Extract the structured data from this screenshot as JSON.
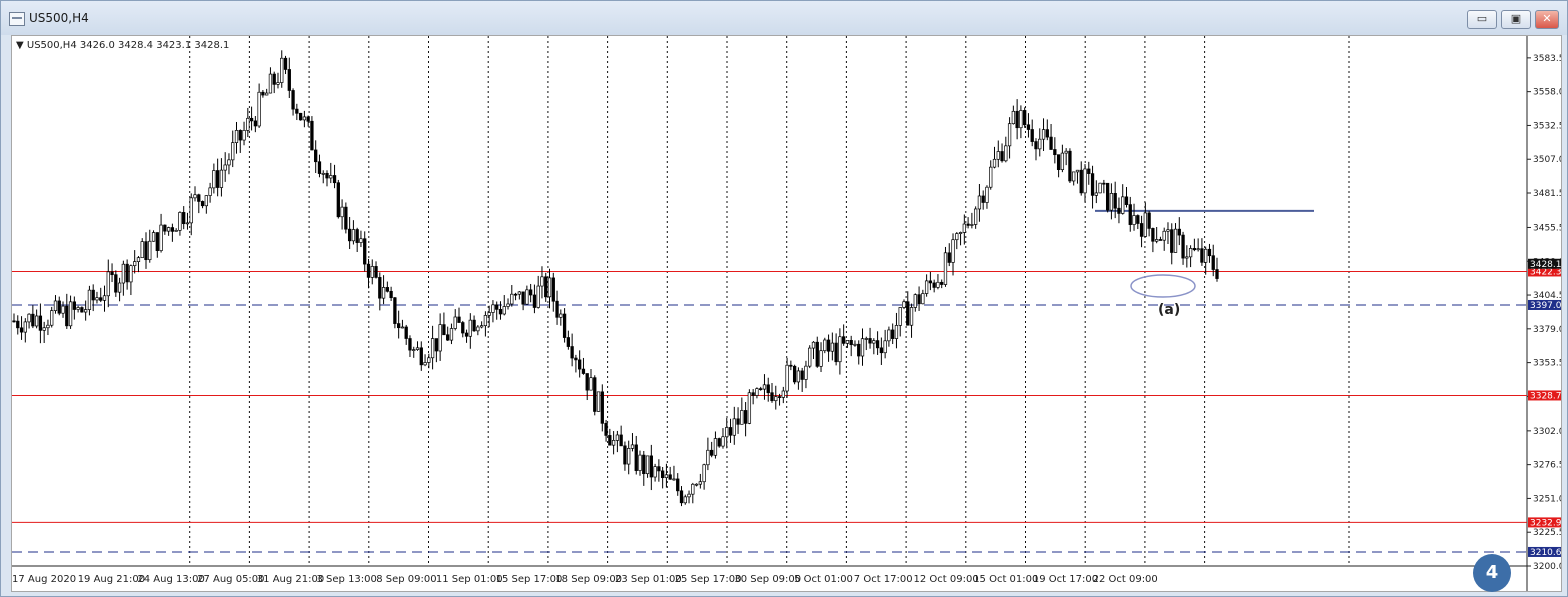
{
  "window": {
    "title": "US500,H4"
  },
  "window_buttons": {
    "minimize": "▭",
    "restore": "▣",
    "close": "✕"
  },
  "chart": {
    "info_text": "▼ US500,H4  3426.0 3428.4 3423.1 3428.1",
    "price_ticks": [
      "3583.5",
      "3558.0",
      "3532.5",
      "3507.0",
      "3481.5",
      "3455.5",
      "3430.0",
      "3404.5",
      "3379.0",
      "3353.5",
      "3328.0",
      "3302.0",
      "3276.5",
      "3251.0",
      "3225.5",
      "3200.0"
    ],
    "price_tick_values": [
      3583.5,
      3558.0,
      3532.5,
      3507.0,
      3481.5,
      3455.5,
      3430.0,
      3404.5,
      3379.0,
      3353.5,
      3328.0,
      3302.0,
      3276.5,
      3251.0,
      3225.5,
      3200.0
    ],
    "time_labels": [
      "17 Aug 2020",
      "19 Aug 21:00",
      "24 Aug 13:00",
      "27 Aug 05:00",
      "31 Aug 21:00",
      "3 Sep 13:00",
      "8 Sep 09:00",
      "11 Sep 01:00",
      "15 Sep 17:00",
      "18 Sep 09:00",
      "23 Sep 01:00",
      "25 Sep 17:00",
      "30 Sep 09:00",
      "5 Oct 01:00",
      "7 Oct 17:00",
      "12 Oct 09:00",
      "15 Oct 01:00",
      "19 Oct 17:00",
      "22 Oct 09:00"
    ],
    "levels": [
      {
        "price": 3422.3,
        "label": "3422.3",
        "style": "solid",
        "color": "#e31a1a"
      },
      {
        "price": 3397.0,
        "label": "3397.0",
        "style": "dashed",
        "color": "#1f2f8a"
      },
      {
        "price": 3328.7,
        "label": "3328.7",
        "style": "solid",
        "color": "#e31a1a"
      },
      {
        "price": 3232.9,
        "label": "3232.9",
        "style": "solid",
        "color": "#e31a1a"
      },
      {
        "price": 3210.6,
        "label": "3210.6",
        "style": "dashed",
        "color": "#1f2f8a"
      }
    ],
    "current_price_label": "3428.1",
    "resistance_price": 3468.0,
    "annotation": "(a)",
    "badge": "4",
    "colors": {
      "accent": "#3d6ea8",
      "support": "#e31a1a",
      "dashed": "#1f2f8a",
      "resistance": "#4b5d9a"
    }
  },
  "chart_data": {
    "type": "line",
    "title": "US500,H4",
    "ylim": [
      3200.0,
      3600.0
    ],
    "x": [
      "17 Aug 2020",
      "19 Aug 21:00",
      "24 Aug 13:00",
      "27 Aug 05:00",
      "31 Aug 21:00",
      "3 Sep 13:00",
      "8 Sep 09:00",
      "11 Sep 01:00",
      "15 Sep 17:00",
      "18 Sep 09:00",
      "23 Sep 01:00",
      "25 Sep 17:00",
      "30 Sep 09:00",
      "5 Oct 01:00",
      "7 Oct 17:00",
      "12 Oct 09:00",
      "15 Oct 01:00",
      "19 Oct 17:00",
      "22 Oct 09:00"
    ],
    "series": [
      {
        "values": [
          3385,
          3392,
          3440,
          3490,
          3575,
          3455,
          3360,
          3390,
          3410,
          3290,
          3255,
          3320,
          3360,
          3370,
          3430,
          3540,
          3490,
          3455,
          3425
        ]
      }
    ]
  }
}
